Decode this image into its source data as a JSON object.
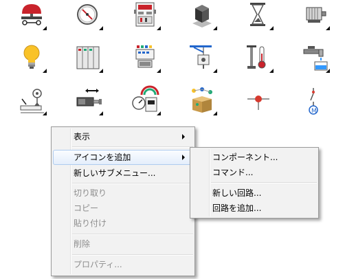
{
  "icons": [
    {
      "name": "push-button-icon"
    },
    {
      "name": "gauge-icon"
    },
    {
      "name": "control-panel-icon"
    },
    {
      "name": "box-icon"
    },
    {
      "name": "hourglass-icon"
    },
    {
      "name": "motor-icon"
    },
    {
      "name": "lightbulb-icon"
    },
    {
      "name": "cabinet-icon"
    },
    {
      "name": "plc-module-icon"
    },
    {
      "name": "hoist-icon"
    },
    {
      "name": "thermometer-icon"
    },
    {
      "name": "faucet-icon"
    },
    {
      "name": "sensor-icon"
    },
    {
      "name": "cylinder-icon"
    },
    {
      "name": "meters-icon"
    },
    {
      "name": "package-network-icon"
    },
    {
      "name": "junction-node-icon"
    },
    {
      "name": "motor-symbol-icon"
    }
  ],
  "context_menu": {
    "items": [
      {
        "label": "表示",
        "submenu": true
      },
      {
        "label": "アイコンを追加",
        "submenu": true,
        "highlighted": true
      },
      {
        "label": "新しいサブメニュー..."
      },
      {
        "label": "切り取り",
        "disabled": true
      },
      {
        "label": "コピー",
        "disabled": true
      },
      {
        "label": "貼り付け",
        "disabled": true
      },
      {
        "label": "削除",
        "disabled": true
      },
      {
        "label": "プロパティ...",
        "disabled": true
      }
    ]
  },
  "submenu": {
    "items": [
      {
        "label": "コンポーネント..."
      },
      {
        "label": "コマンド..."
      },
      {
        "label": "新しい回路..."
      },
      {
        "label": "回路を追加..."
      }
    ]
  }
}
